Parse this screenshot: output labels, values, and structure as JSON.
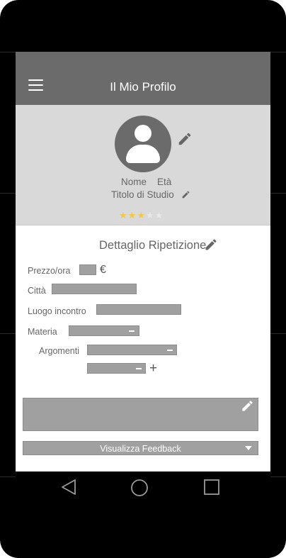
{
  "app_bar": {
    "title": "Il Mio Profilo",
    "menu_icon": "hamburger-menu-icon"
  },
  "profile": {
    "name_label": "Nome",
    "age_label": "Età",
    "degree_label": "Titolo di Studio",
    "rating": 3,
    "rating_max": 5,
    "avatar_icon": "person-icon",
    "edit_icon": "pencil-icon"
  },
  "details": {
    "title": "Dettaglio Ripetizione",
    "price_label": "Prezzo/ora",
    "currency": "€",
    "city_label": "Città",
    "place_label": "Luogo incontro",
    "subject_label": "Materia",
    "topics_label": "Argomenti",
    "add_symbol": "+"
  },
  "feedback": {
    "label": "Visualizza Feedback"
  },
  "colors": {
    "app_bar": "#6b6b6b",
    "profile_bg": "#d9d9d9",
    "field": "#a0a0a0",
    "star_on": "#f5c842",
    "star_off": "#e8e8e8"
  },
  "nav_bar": {
    "icons": [
      "back-icon",
      "home-icon",
      "recents-icon"
    ]
  }
}
